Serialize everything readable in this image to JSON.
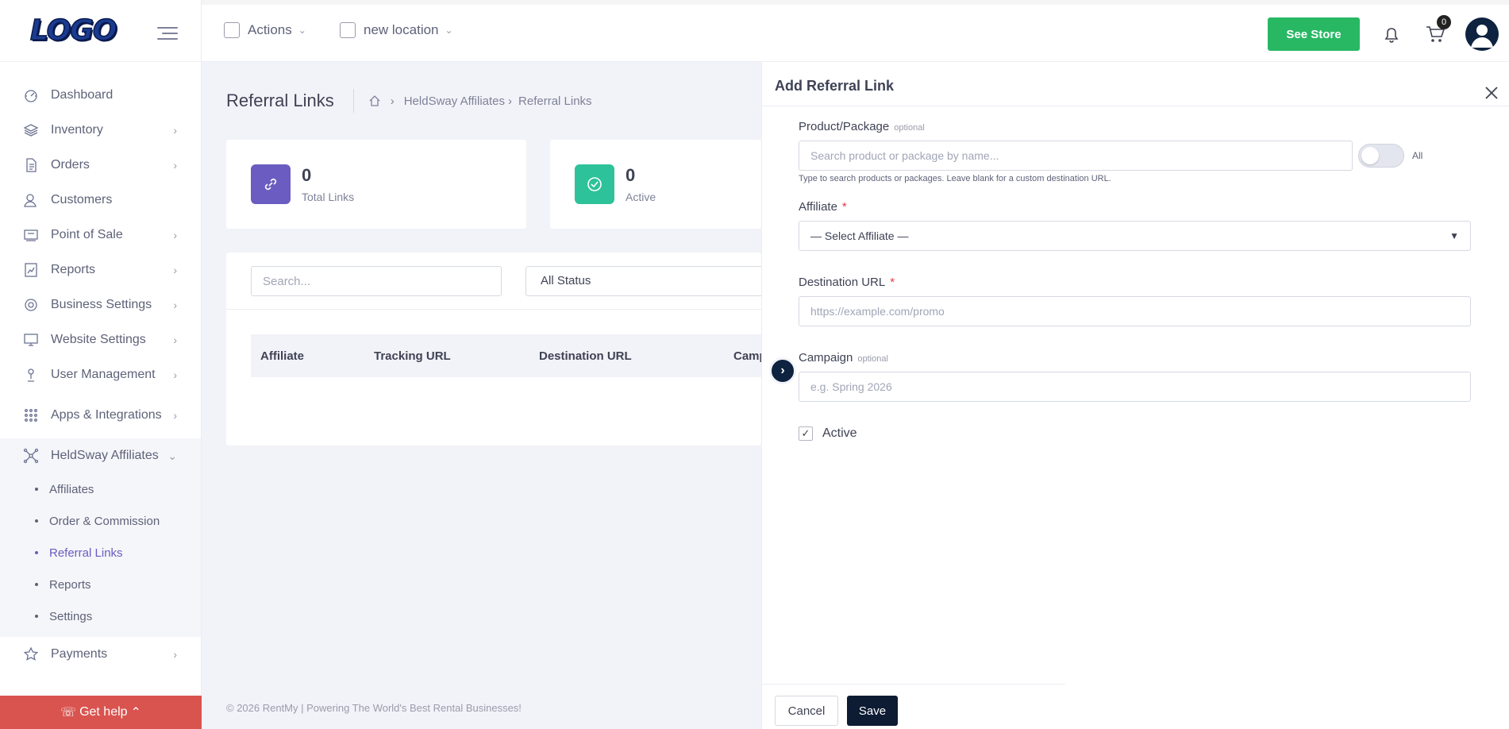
{
  "brand": {
    "logo_text": "LOGO"
  },
  "sidebar": {
    "items": [
      {
        "label": "Dashboard",
        "icon": "dashboard-icon"
      },
      {
        "label": "Inventory",
        "icon": "layers-icon"
      },
      {
        "label": "Orders",
        "icon": "document-icon"
      },
      {
        "label": "Customers",
        "icon": "user-icon"
      },
      {
        "label": "Point of Sale",
        "icon": "pos-icon"
      },
      {
        "label": "Reports",
        "icon": "chart-icon"
      },
      {
        "label": "Business Settings",
        "icon": "gear-icon"
      },
      {
        "label": "Website Settings",
        "icon": "monitor-icon"
      },
      {
        "label": "User Management",
        "icon": "users-icon"
      },
      {
        "label": "Apps & Integrations",
        "icon": "grid-icon"
      },
      {
        "label": "HeldSway Affiliates",
        "icon": "network-icon"
      },
      {
        "label": "Payments",
        "icon": "star-icon"
      }
    ],
    "affiliates_sub": [
      "Affiliates",
      "Order & Commission",
      "Referral Links",
      "Reports",
      "Settings"
    ],
    "get_help": "Get help"
  },
  "topbar": {
    "actions_label": "Actions",
    "location_label": "new location",
    "see_store": "See Store",
    "cart_count": "0"
  },
  "page": {
    "title": "Referral Links",
    "breadcrumb": [
      "HeldSway Affiliates",
      "Referral Links"
    ],
    "stats": [
      {
        "value": "0",
        "label": "Total Links",
        "color": "#6a5cc0"
      },
      {
        "value": "0",
        "label": "Active",
        "color": "#2ec29a"
      }
    ],
    "search_placeholder": "Search...",
    "status_filter": "All Status",
    "columns": [
      "Affiliate",
      "Tracking URL",
      "Destination URL",
      "Camp"
    ],
    "footer": "© 2026 RentMy | Powering The World's Best Rental Businesses!"
  },
  "drawer": {
    "title": "Add Referral Link",
    "product_label": "Product/Package",
    "optional": "optional",
    "product_placeholder": "Search product or package by name...",
    "toggle_label": "All",
    "help_text": "Type to search products or packages. Leave blank for a custom destination URL.",
    "affiliate_label": "Affiliate",
    "affiliate_select": "— Select Affiliate —",
    "destination_label": "Destination URL",
    "destination_placeholder": "https://example.com/promo",
    "campaign_label": "Campaign",
    "campaign_placeholder": "e.g. Spring 2026",
    "active_label": "Active",
    "active_checked": true,
    "required_mark": "*",
    "cancel": "Cancel",
    "save": "Save"
  }
}
